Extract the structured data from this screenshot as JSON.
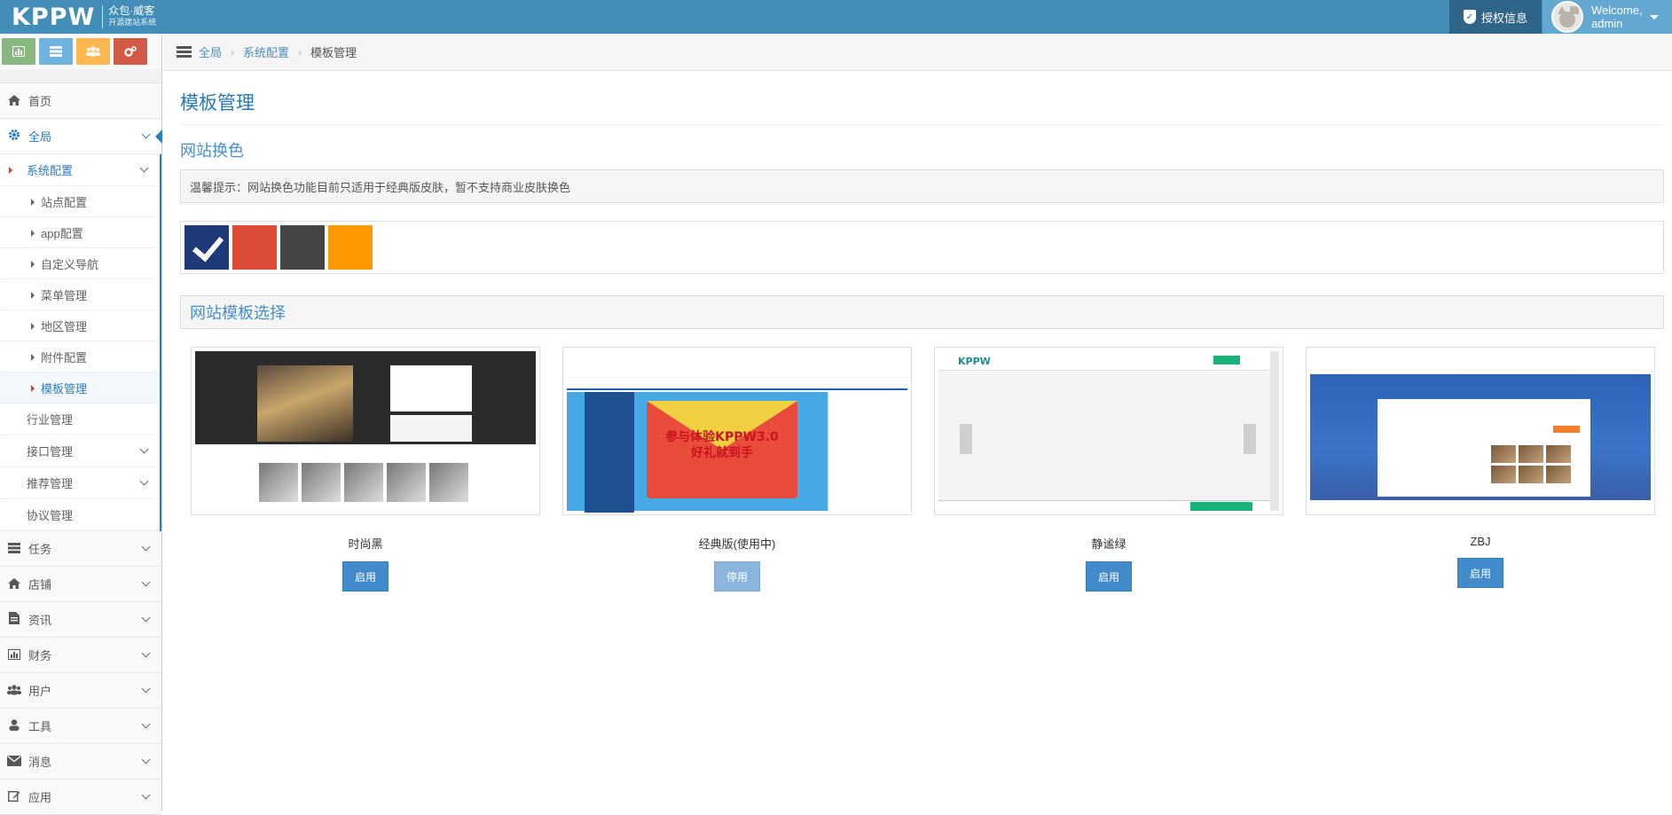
{
  "navbar": {
    "logo": "KPPW",
    "logo_line1": "众包·威客",
    "logo_line2": "开源建站系统",
    "auth_label": "授权信息",
    "welcome": "Welcome,",
    "username": "admin"
  },
  "shortcuts": [
    {
      "icon": "chart-icon",
      "color": "#87b87f"
    },
    {
      "icon": "list-icon",
      "color": "#6fb3e0"
    },
    {
      "icon": "users-icon",
      "color": "#ffb752"
    },
    {
      "icon": "cogs-icon",
      "color": "#d15b47"
    }
  ],
  "sidebar": {
    "home": "首页",
    "global": "全局",
    "system_config": "系统配置",
    "system_items": [
      "站点配置",
      "app配置",
      "自定义导航",
      "菜单管理",
      "地区管理",
      "附件配置",
      "模板管理"
    ],
    "industry": "行业管理",
    "interface": "接口管理",
    "recommend": "推荐管理",
    "protocol": "协议管理",
    "task": "任务",
    "shop": "店铺",
    "news": "资讯",
    "finance": "财务",
    "user": "用户",
    "tools": "工具",
    "message": "消息",
    "apps": "应用"
  },
  "breadcrumb": {
    "home": "全局",
    "parent": "系统配置",
    "current": "模板管理"
  },
  "main": {
    "title": "模板管理",
    "color_section": "网站换色",
    "tip": "温馨提示：网站换色功能目前只适用于经典版皮肤，暂不支持商业皮肤换色",
    "colors": [
      "#1e3a78",
      "#dd4b39",
      "#444444",
      "#ff9900"
    ],
    "selected_color": 0,
    "template_section": "网站模板选择",
    "templates": [
      {
        "name": "时尚黑",
        "button": "启用",
        "active": false
      },
      {
        "name": "经典版(使用中)",
        "button": "停用",
        "active": true
      },
      {
        "name": "静谧绿",
        "button": "启用",
        "active": false
      },
      {
        "name": "ZBJ",
        "button": "启用",
        "active": false
      }
    ],
    "thumb2_text_line1": "参与体验KPPW3.0",
    "thumb2_text_line2": "好礼就到手"
  }
}
